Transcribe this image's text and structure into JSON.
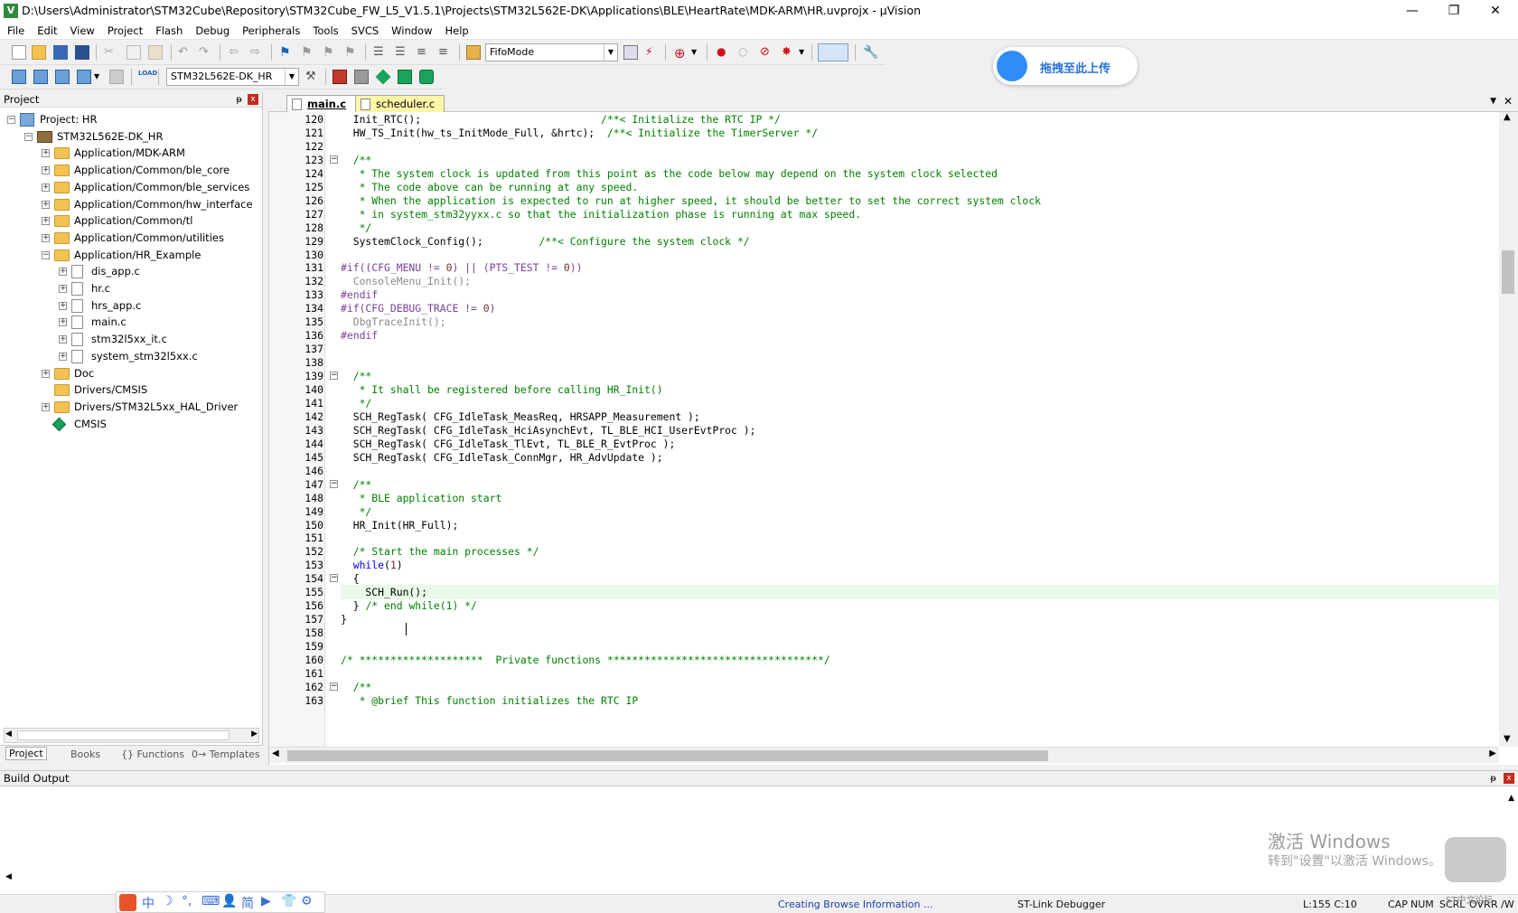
{
  "window": {
    "title": "D:\\Users\\Administrator\\STM32Cube\\Repository\\STM32Cube_FW_L5_V1.5.1\\Projects\\STM32L562E-DK\\Applications\\BLE\\HeartRate\\MDK-ARM\\HR.uvprojx - µVision",
    "app_icon_letter": "V",
    "minimize": "—",
    "restore": "❐",
    "close": "✕"
  },
  "menu": [
    "File",
    "Edit",
    "View",
    "Project",
    "Flash",
    "Debug",
    "Peripherals",
    "Tools",
    "SVCS",
    "Window",
    "Help"
  ],
  "toolbar": {
    "find_combo": "FifoMode",
    "target_combo": "STM32L562E-DK_HR"
  },
  "upload_button": {
    "label": "拖拽至此上传"
  },
  "project_panel": {
    "title": "Project",
    "pin": "ᵽ",
    "close": "x",
    "tree": [
      {
        "label": "Project: HR",
        "indent": 0,
        "icon": "proj",
        "exp": "−"
      },
      {
        "label": "STM32L562E-DK_HR",
        "indent": 1,
        "icon": "target",
        "exp": "−"
      },
      {
        "label": "Application/MDK-ARM",
        "indent": 2,
        "icon": "folder",
        "exp": "+"
      },
      {
        "label": "Application/Common/ble_core",
        "indent": 2,
        "icon": "folder",
        "exp": "+"
      },
      {
        "label": "Application/Common/ble_services",
        "indent": 2,
        "icon": "folder",
        "exp": "+"
      },
      {
        "label": "Application/Common/hw_interface",
        "indent": 2,
        "icon": "folder",
        "exp": "+"
      },
      {
        "label": "Application/Common/tl",
        "indent": 2,
        "icon": "folder",
        "exp": "+"
      },
      {
        "label": "Application/Common/utilities",
        "indent": 2,
        "icon": "folder",
        "exp": "+"
      },
      {
        "label": "Application/HR_Example",
        "indent": 2,
        "icon": "folder",
        "exp": "−"
      },
      {
        "label": "dis_app.c",
        "indent": 3,
        "icon": "file",
        "exp": "+"
      },
      {
        "label": "hr.c",
        "indent": 3,
        "icon": "file",
        "exp": "+"
      },
      {
        "label": "hrs_app.c",
        "indent": 3,
        "icon": "file",
        "exp": "+"
      },
      {
        "label": "main.c",
        "indent": 3,
        "icon": "file",
        "exp": "+"
      },
      {
        "label": "stm32l5xx_it.c",
        "indent": 3,
        "icon": "file",
        "exp": "+"
      },
      {
        "label": "system_stm32l5xx.c",
        "indent": 3,
        "icon": "file",
        "exp": "+"
      },
      {
        "label": "Doc",
        "indent": 2,
        "icon": "folder",
        "exp": "+"
      },
      {
        "label": "Drivers/CMSIS",
        "indent": 2,
        "icon": "folder",
        "exp": ""
      },
      {
        "label": "Drivers/STM32L5xx_HAL_Driver",
        "indent": 2,
        "icon": "folder",
        "exp": "+"
      },
      {
        "label": "CMSIS",
        "indent": 2,
        "icon": "gem",
        "exp": ""
      }
    ],
    "tabs": [
      "Project",
      "Books",
      "{} Functions",
      "0→ Templates"
    ]
  },
  "editor": {
    "tabs": [
      {
        "label": "main.c",
        "active": true
      },
      {
        "label": "scheduler.c",
        "active": false
      }
    ],
    "cursor_line": 155,
    "lines": [
      {
        "n": "120",
        "fold": "",
        "html": "  Init_RTC();                             <span class=\"cm\">/**&lt; Initialize the RTC IP */</span>"
      },
      {
        "n": "121",
        "fold": "",
        "html": "  HW_TS_Init(hw_ts_InitMode_Full, &amp;hrtc);  <span class=\"cm\">/**&lt; Initialize the TimerServer */</span>"
      },
      {
        "n": "122",
        "fold": "",
        "html": ""
      },
      {
        "n": "123",
        "fold": "−",
        "html": "  <span class=\"cm\">/**</span>"
      },
      {
        "n": "124",
        "fold": "",
        "html": "<span class=\"cm\">   * The system clock is updated from this point as the code below may depend on the system clock selected</span>"
      },
      {
        "n": "125",
        "fold": "",
        "html": "<span class=\"cm\">   * The code above can be running at any speed.</span>"
      },
      {
        "n": "126",
        "fold": "",
        "html": "<span class=\"cm\">   * When the application is expected to run at higher speed, it should be better to set the correct system clock</span>"
      },
      {
        "n": "127",
        "fold": "",
        "html": "<span class=\"cm\">   * in system_stm32yyxx.c so that the initialization phase is running at max speed.</span>"
      },
      {
        "n": "128",
        "fold": "",
        "html": "<span class=\"cm\">   */</span>"
      },
      {
        "n": "129",
        "fold": "",
        "html": "  SystemClock_Config();         <span class=\"cm\">/**&lt; Configure the system clock */</span>"
      },
      {
        "n": "130",
        "fold": "",
        "html": ""
      },
      {
        "n": "131",
        "fold": "",
        "html": "<span class=\"pp\">#if((CFG_MENU != <span class=\"num\">0</span>) || (PTS_TEST != <span class=\"num\">0</span>))</span>"
      },
      {
        "n": "132",
        "fold": "",
        "html": "<span class=\"gr\">  ConsoleMenu_Init();</span>"
      },
      {
        "n": "133",
        "fold": "",
        "html": "<span class=\"pp\">#endif</span>"
      },
      {
        "n": "134",
        "fold": "",
        "html": "<span class=\"pp\">#if(CFG_DEBUG_TRACE != <span class=\"num\">0</span>)</span>"
      },
      {
        "n": "135",
        "fold": "",
        "html": "<span class=\"gr\">  DbgTraceInit();</span>"
      },
      {
        "n": "136",
        "fold": "",
        "html": "<span class=\"pp\">#endif</span>"
      },
      {
        "n": "137",
        "fold": "",
        "html": ""
      },
      {
        "n": "138",
        "fold": "",
        "html": ""
      },
      {
        "n": "139",
        "fold": "−",
        "html": "  <span class=\"cm\">/**</span>"
      },
      {
        "n": "140",
        "fold": "",
        "html": "<span class=\"cm\">   * It shall be registered before calling HR_Init()</span>"
      },
      {
        "n": "141",
        "fold": "",
        "html": "<span class=\"cm\">   */</span>"
      },
      {
        "n": "142",
        "fold": "",
        "html": "  SCH_RegTask( CFG_IdleTask_MeasReq, HRSAPP_Measurement );"
      },
      {
        "n": "143",
        "fold": "",
        "html": "  SCH_RegTask( CFG_IdleTask_HciAsynchEvt, TL_BLE_HCI_UserEvtProc );"
      },
      {
        "n": "144",
        "fold": "",
        "html": "  SCH_RegTask( CFG_IdleTask_TlEvt, TL_BLE_R_EvtProc );"
      },
      {
        "n": "145",
        "fold": "",
        "html": "  SCH_RegTask( CFG_IdleTask_ConnMgr, HR_AdvUpdate );"
      },
      {
        "n": "146",
        "fold": "",
        "html": ""
      },
      {
        "n": "147",
        "fold": "−",
        "html": "  <span class=\"cm\">/**</span>"
      },
      {
        "n": "148",
        "fold": "",
        "html": "<span class=\"cm\">   * BLE application start</span>"
      },
      {
        "n": "149",
        "fold": "",
        "html": "<span class=\"cm\">   */</span>"
      },
      {
        "n": "150",
        "fold": "",
        "html": "  HR_Init(HR_Full);"
      },
      {
        "n": "151",
        "fold": "",
        "html": ""
      },
      {
        "n": "152",
        "fold": "",
        "html": "  <span class=\"cm\">/* Start the main processes */</span>"
      },
      {
        "n": "153",
        "fold": "",
        "html": "  <span class=\"kw\">while</span>(<span class=\"num\">1</span>)"
      },
      {
        "n": "154",
        "fold": "−",
        "html": "  {"
      },
      {
        "n": "155",
        "fold": "",
        "html": "    SCH_Run();"
      },
      {
        "n": "156",
        "fold": "",
        "html": "  } <span class=\"cm\">/* end while(1) */</span>"
      },
      {
        "n": "157",
        "fold": "",
        "html": "}"
      },
      {
        "n": "158",
        "fold": "",
        "html": ""
      },
      {
        "n": "159",
        "fold": "",
        "html": ""
      },
      {
        "n": "160",
        "fold": "",
        "html": "<span class=\"cm\">/* ********************  Private functions ***********************************/</span>"
      },
      {
        "n": "161",
        "fold": "",
        "html": ""
      },
      {
        "n": "162",
        "fold": "−",
        "html": "  <span class=\"cm\">/**</span>"
      },
      {
        "n": "163",
        "fold": "",
        "html": "<span class=\"cm\">   * @brief This function initializes the RTC IP</span>"
      }
    ]
  },
  "build_output": {
    "title": "Build Output"
  },
  "watermark": {
    "line1": "激活 Windows",
    "line2": "转到\"设置\"以激活 Windows。"
  },
  "statusbar": {
    "message": "Creating Browse Information ...",
    "debugger": "ST-Link Debugger",
    "position": "L:155 C:10",
    "cap": "CAP",
    "num": "NUM",
    "scrl": "SCRL",
    "ovr": "OVR",
    "rw": "R /W"
  },
  "ime_bar": [
    "中",
    "☽",
    "°,",
    "⌨",
    "👤",
    "简",
    "▶",
    "👕",
    "⚙"
  ],
  "forum_mark": "ST中文论坛"
}
